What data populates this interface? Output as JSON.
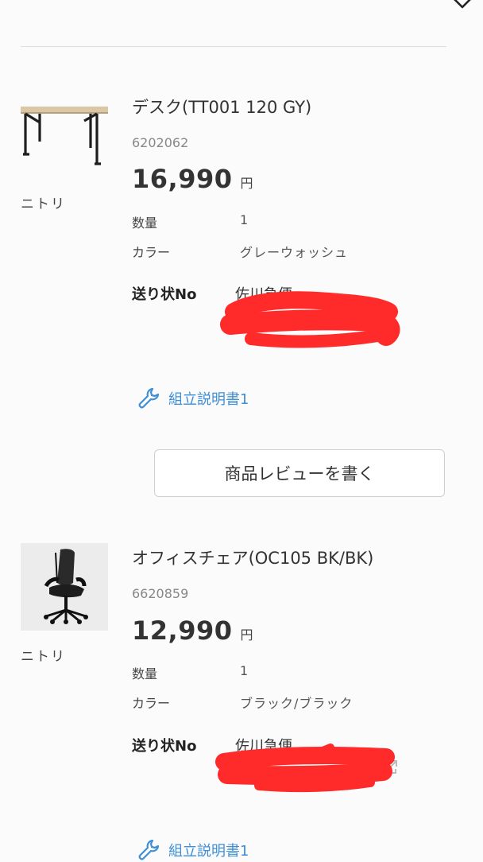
{
  "items": [
    {
      "name": "デスク(TT001 120 GY)",
      "code": "6202062",
      "price": "16,990",
      "currency": "円",
      "brand": "ニトリ",
      "quantity_label": "数量",
      "quantity": "1",
      "color_label": "カラー",
      "color": "グレーウォッシュ",
      "shipping_label": "送り状No",
      "carrier": "佐川急便",
      "manual_link": "組立説明書1"
    },
    {
      "name": "オフィスチェア(OC105 BK/BK)",
      "code": "6620859",
      "price": "12,990",
      "currency": "円",
      "brand": "ニトリ",
      "quantity_label": "数量",
      "quantity": "1",
      "color_label": "カラー",
      "color": "ブラック/ブラック",
      "shipping_label": "送り状No",
      "carrier": "佐川急便",
      "manual_link": "組立説明書1"
    }
  ],
  "review_button": "商品レビューを書く",
  "colors": {
    "link": "#3e8ed8",
    "redaction": "#ff2a2a",
    "divider": "#dedede"
  }
}
